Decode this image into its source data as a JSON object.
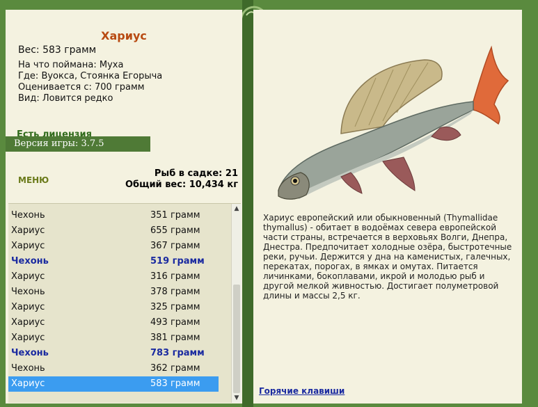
{
  "fish": {
    "name": "Хариус",
    "weight_label": "Вес:",
    "weight_value": "583 грамм",
    "bait_label": "На что поймана:",
    "bait_value": "Муха",
    "location_label": "Где:",
    "location_value": "Вуокса, Стоянка Егорыча",
    "rated_label": "Оценивается с:",
    "rated_value": "700 грамм",
    "kind_label": "Вид:",
    "kind_value": "Ловится редко",
    "description": "Хариус европейский или обыкновенный (Thymallidae thymallus) - обитает в водоёмах севера европейской части страны, встречается в верховьях Волги, Днепра, Днестра. Предпочитает холодные озёра, быстротечные реки, ручьи. Держится у дна на каменистых, галечных, перекатах, порогах, в ямках и омутах. Питается личинками, бокоплавами, икрой и молодью рыб и другой мелкой живностью. Достигает полуметровой длины и массы 2,5 кг."
  },
  "license": "Есть лицензия",
  "version": "Версия игры: 3.7.5",
  "menu_label": "МЕНЮ",
  "stats": {
    "count_label": "Рыб в садке:",
    "count_value": "21",
    "total_label": "Общий вес:",
    "total_value": "10,434 кг"
  },
  "catch_list": [
    {
      "name": "Чехонь",
      "grams": "351 грамм",
      "highlight": false
    },
    {
      "name": "Хариус",
      "grams": "655 грамм",
      "highlight": false
    },
    {
      "name": "Хариус",
      "grams": "367 грамм",
      "highlight": false
    },
    {
      "name": "Чехонь",
      "grams": "519 грамм",
      "highlight": true
    },
    {
      "name": "Хариус",
      "grams": "316 грамм",
      "highlight": false
    },
    {
      "name": "Чехонь",
      "grams": "378 грамм",
      "highlight": false
    },
    {
      "name": "Хариус",
      "grams": "325 грамм",
      "highlight": false
    },
    {
      "name": "Хариус",
      "grams": "493 грамм",
      "highlight": false
    },
    {
      "name": "Хариус",
      "grams": "381 грамм",
      "highlight": false
    },
    {
      "name": "Чехонь",
      "grams": "783 грамм",
      "highlight": true
    },
    {
      "name": "Чехонь",
      "grams": "362 грамм",
      "highlight": false
    },
    {
      "name": "Хариус",
      "grams": "583 грамм",
      "highlight": false,
      "selected": true
    }
  ],
  "hotkeys_label": "Горячие клавиши",
  "icons": {
    "scroll_up": "triangle-up",
    "scroll_down": "triangle-down",
    "fish_picture": "grayling-fish-image"
  },
  "colors": {
    "frame_green": "#4f7a36",
    "panel_bg": "#f4f2e0",
    "title_color": "#b84a12",
    "highlight_blue": "#1a2aa0",
    "selected_row": "#3b9cf0"
  }
}
